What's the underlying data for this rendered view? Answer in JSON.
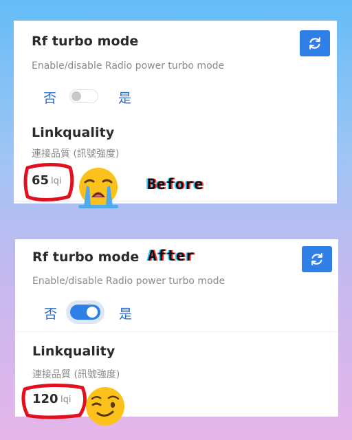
{
  "before": {
    "rf": {
      "title": "Rf turbo mode",
      "subtitle": "Enable/disable Radio power turbo mode",
      "toggle_off_label": "否",
      "toggle_on_label": "是",
      "toggle_state": "off"
    },
    "link": {
      "title": "Linkquality",
      "subtitle": "連接品質 (訊號強度)",
      "value": "65",
      "unit": "lqi"
    },
    "annotation": "Before",
    "emoji": "crying-face"
  },
  "after": {
    "rf": {
      "title": "Rf turbo mode",
      "subtitle": "Enable/disable Radio power turbo mode",
      "toggle_off_label": "否",
      "toggle_on_label": "是",
      "toggle_state": "on"
    },
    "link": {
      "title": "Linkquality",
      "subtitle": "連接品質 (訊號強度)",
      "value": "120",
      "unit": "lqi"
    },
    "annotation": "After",
    "emoji": "winking-face"
  },
  "colors": {
    "accent": "#2f80e6",
    "circle_annotation": "#e0101e"
  },
  "icons": {
    "refresh": "refresh-icon"
  }
}
